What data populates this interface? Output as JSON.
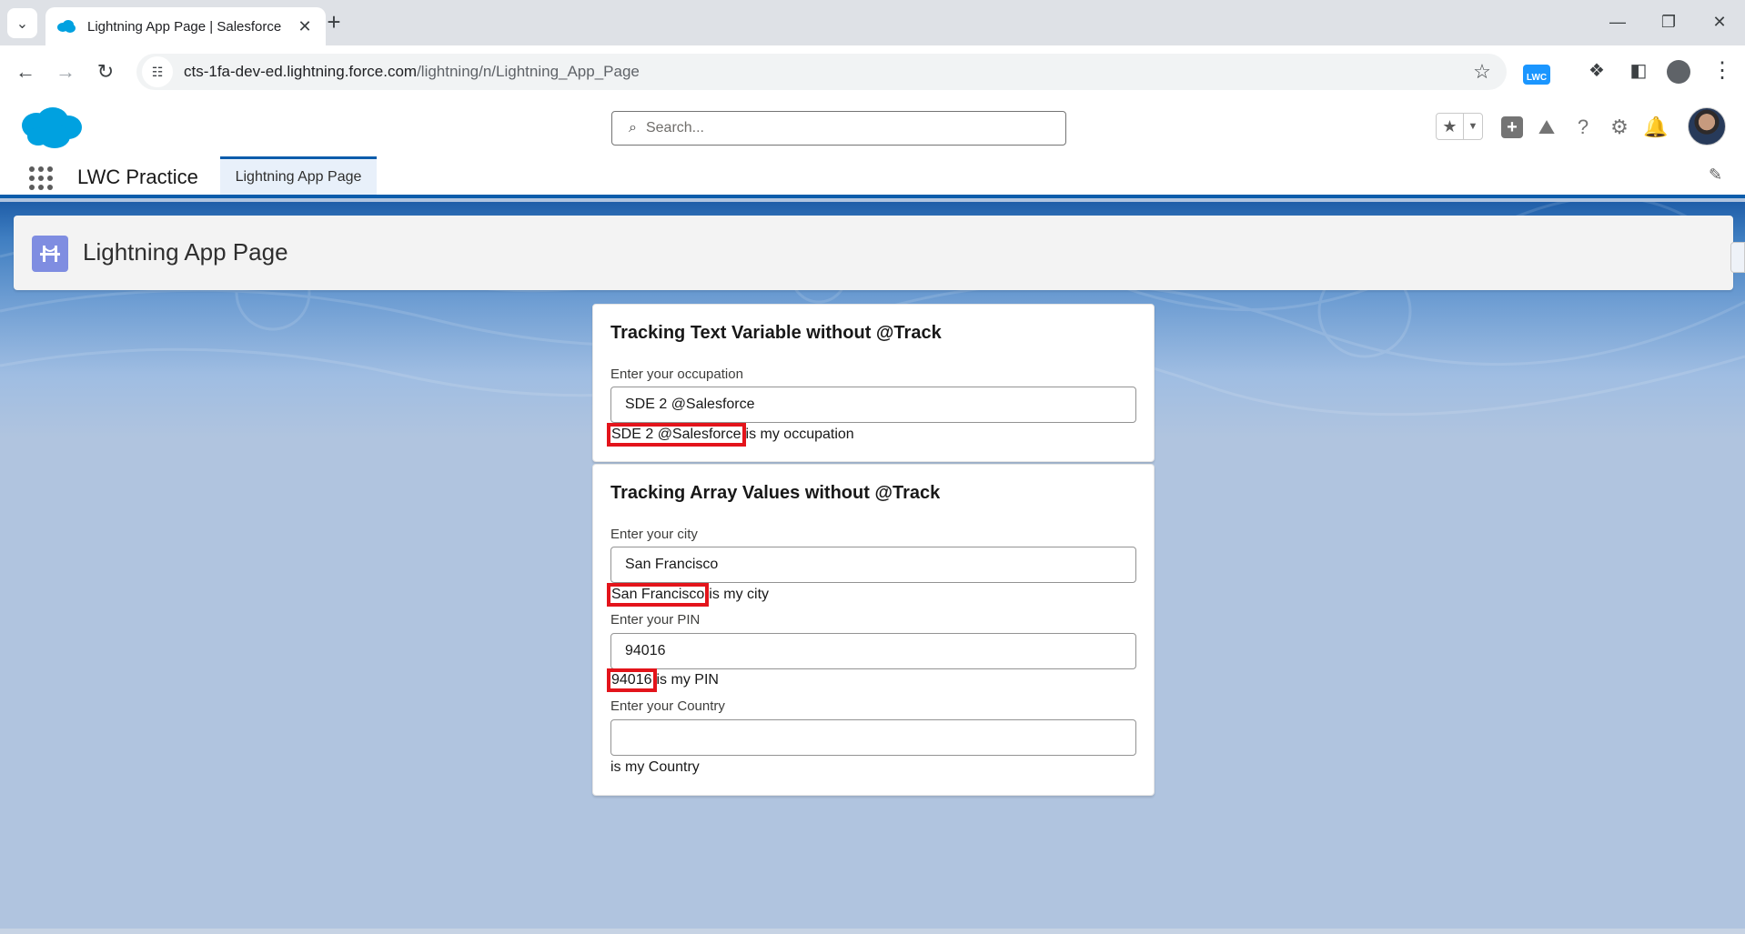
{
  "browser": {
    "tab_title": "Lightning App Page | Salesforce",
    "url_host": "cts-1fa-dev-ed.lightning.force.com",
    "url_path": "/lightning/n/Lightning_App_Page",
    "extension_badge": "LWC"
  },
  "sf_header": {
    "search_placeholder": "Search..."
  },
  "sf_nav": {
    "app_name": "LWC Practice",
    "tabs": [
      {
        "label": "Lightning App Page"
      }
    ]
  },
  "page_header": {
    "title": "Lightning App Page"
  },
  "card_text": {
    "title": "Tracking Text Variable without @Track",
    "label": "Enter your occupation",
    "value": "SDE 2 @Salesforce",
    "output_value": "SDE 2 @Salesforce",
    "output_suffix": "is my occupation"
  },
  "card_array": {
    "title": "Tracking Array Values without @Track",
    "city": {
      "label": "Enter your city",
      "value": "San Francisco",
      "output_value": "San Francisco",
      "output_suffix": "is my city"
    },
    "pin": {
      "label": "Enter your PIN",
      "value": "94016",
      "output_value": "94016",
      "output_suffix": "is my PIN"
    },
    "country": {
      "label": "Enter your Country",
      "value": "",
      "output_suffix": "is my Country"
    }
  },
  "colors": {
    "highlight_box": "#e3141b",
    "salesforce_blue": "#0b5cab",
    "page_icon": "#7f8de1"
  }
}
